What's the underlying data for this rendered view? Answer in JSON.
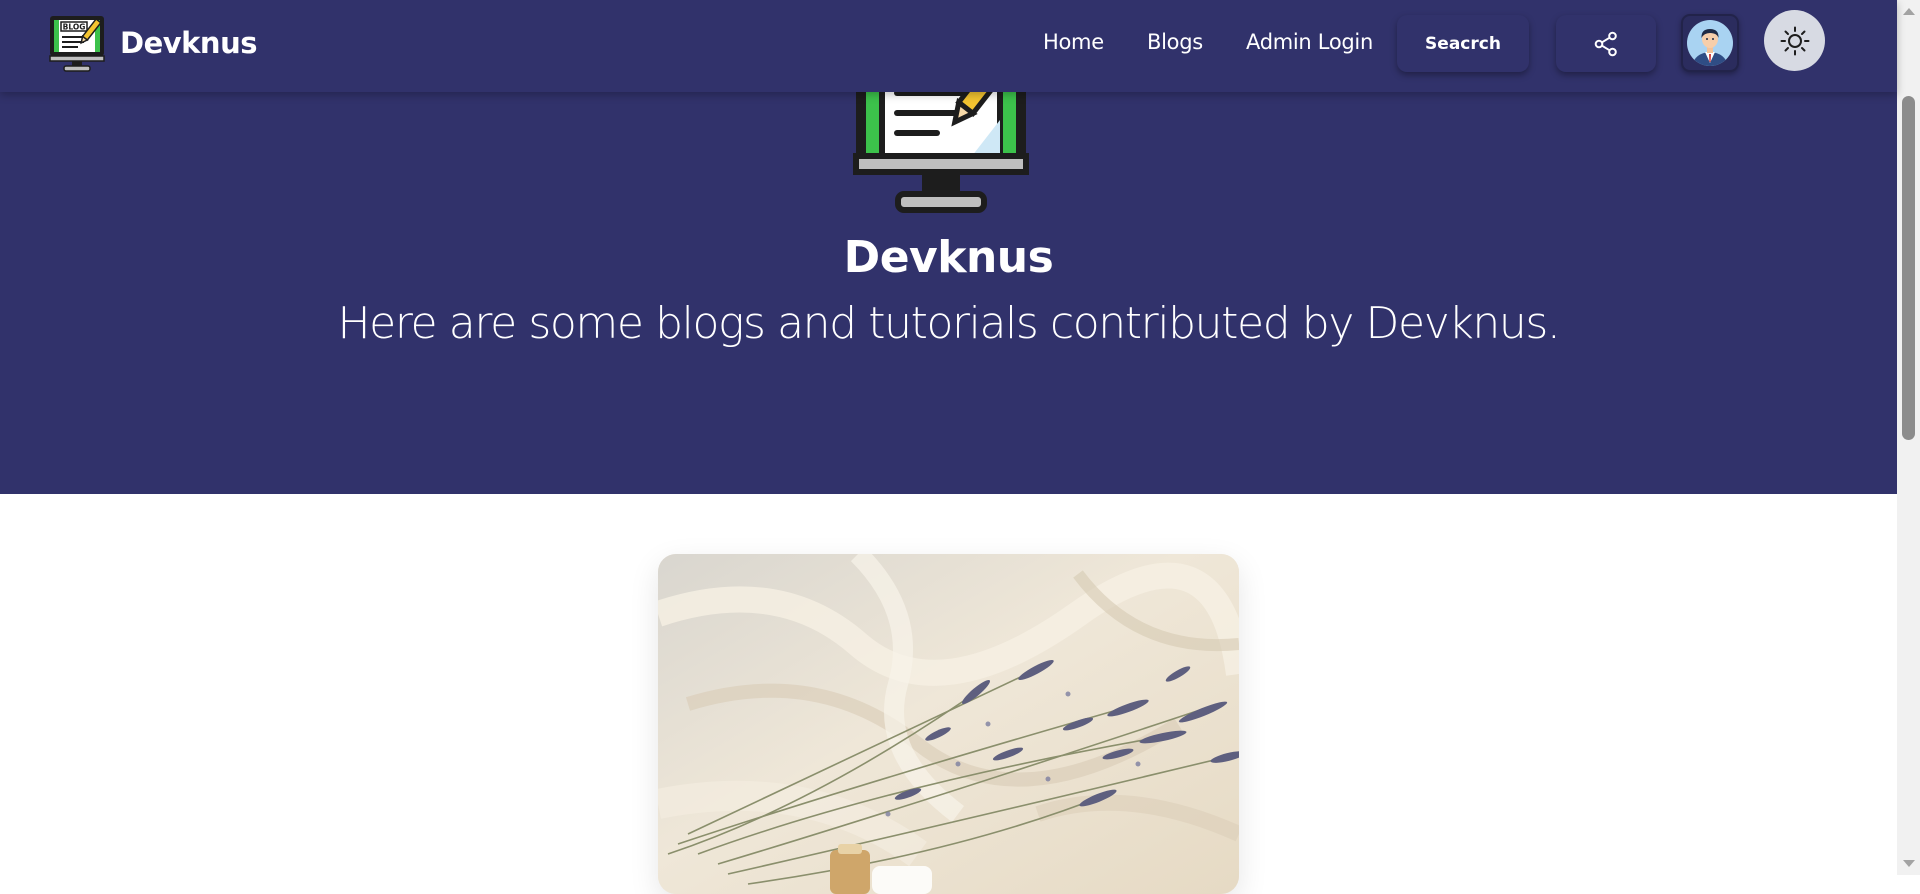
{
  "header": {
    "brand_name": "Devknus",
    "nav": {
      "home": "Home",
      "blogs": "Blogs",
      "admin_login": "Admin Login"
    },
    "search_label": "Seacrch",
    "icons": {
      "logo": "blog-monitor-icon",
      "share": "share-icon",
      "avatar": "user-avatar-icon",
      "theme": "sun-icon"
    }
  },
  "hero": {
    "title": "Devknus",
    "subtitle": "Here are some blogs and tutorials contributed by Devknus."
  },
  "featured_card": {
    "image": "lavender-on-cream-fabric"
  },
  "colors": {
    "primary": "#31326b",
    "background": "#ffffff",
    "text_on_primary": "#ffffff",
    "theme_toggle": "#d7dae3"
  }
}
